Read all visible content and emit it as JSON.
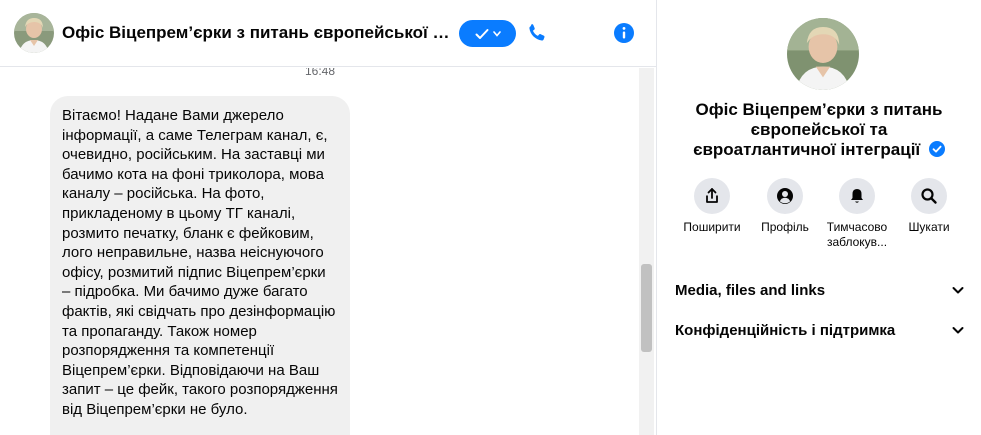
{
  "header": {
    "title": "Офіс Віцепрем’єрки з питань європейської та євроатлантичної інтеграції",
    "avatar_icon": "avatar-photo",
    "mark_button_icon": "checkmark-icon",
    "call_icon": "phone-icon",
    "info_icon": "info-icon"
  },
  "messages": {
    "timestamp": "16:48",
    "items": [
      {
        "text": "Вітаємо! Надане Вами джерело інформації, а саме Телеграм канал, є, очевидно, російським. На заставці ми бачимо кота на фоні триколора, мова каналу – російська. На фото, прикладеному в цьому ТГ каналі, розмито печатку, бланк є фейковим, лого неправильне, назва неіснуючого офісу, розмитий підпис Віцепрем’єрки – підробка. Ми бачимо дуже багато фактів, які свідчать про дезінформацію та пропаганду. Також номер розпорядження та компетенції Віцепрем’єрки. Відповідаючи на Ваш запит – це фейк, такого розпорядження від Віцепрем’єрки не було."
      }
    ]
  },
  "info_panel": {
    "name": "Офіс Віцепрем’єрки з питань європейської та євроатлантичної інтеграції",
    "verified_icon": "verified-badge-icon",
    "actions": [
      {
        "label": "Поширити",
        "icon": "share-icon"
      },
      {
        "label": "Профіль",
        "icon": "profile-icon"
      },
      {
        "label": "Тимчасово заблокув...",
        "icon": "bell-icon"
      },
      {
        "label": "Шукати",
        "icon": "search-icon"
      }
    ],
    "sections": [
      {
        "title": "Media, files and links"
      },
      {
        "title": "Конфіденційність і підтримка"
      }
    ]
  },
  "colors": {
    "accent": "#0a7cff",
    "bubble": "#f0f0f0",
    "action_bg": "#e4e6eb",
    "divider": "#e4e6eb"
  }
}
